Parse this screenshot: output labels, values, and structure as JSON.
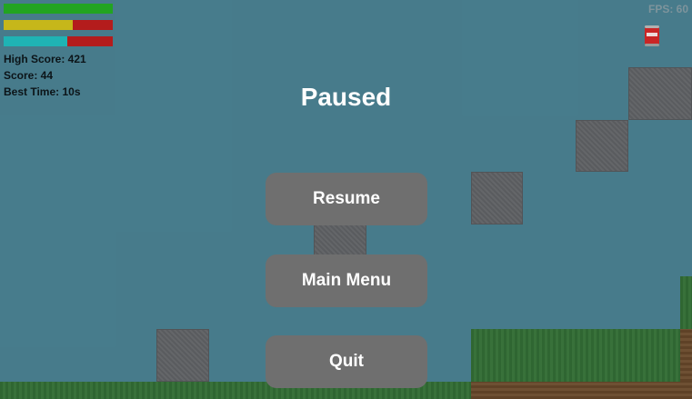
{
  "hud": {
    "health": 1.0,
    "stamina": 0.63,
    "energy": 0.58,
    "high_score_text": "High Score: 421",
    "score_text": "Score: 44",
    "best_time_text": "Best Time: 10s",
    "fps_text": "FPS: 60",
    "colors": {
      "health": "#22a422",
      "stamina": "#c6b71a",
      "energy": "#1fb3b4",
      "deficit": "#b41c1c"
    },
    "item_icon": "soda-can-icon"
  },
  "pause_menu": {
    "title": "Paused",
    "buttons": [
      {
        "label": "Resume"
      },
      {
        "label": "Main Menu"
      },
      {
        "label": "Quit"
      }
    ]
  }
}
